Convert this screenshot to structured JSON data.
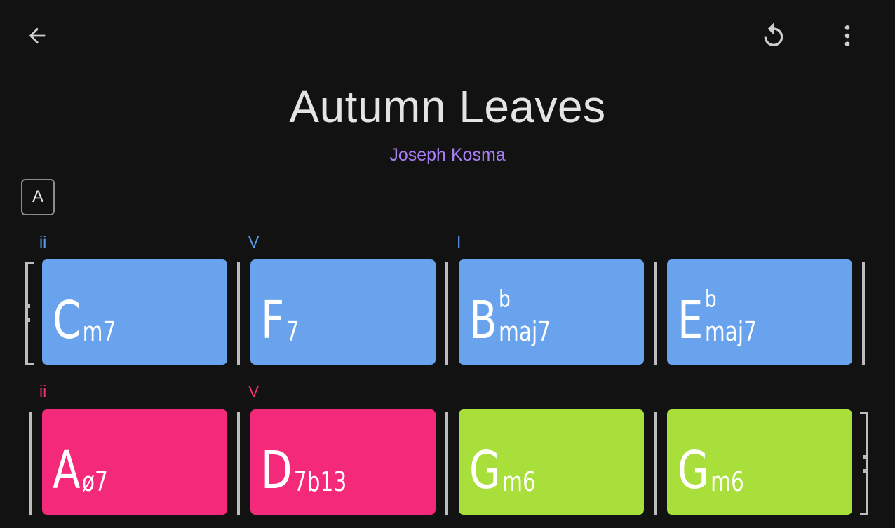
{
  "toolbar": {
    "back_icon": "arrow-back-icon",
    "reset_icon": "refresh-icon",
    "more_icon": "more-vert-icon"
  },
  "song": {
    "title": "Autumn Leaves",
    "composer": "Joseph Kosma"
  },
  "section": {
    "label": "A"
  },
  "colors": {
    "background": "#121212",
    "blue": "#6aa3ed",
    "pink": "#f5297a",
    "green": "#a9df3b",
    "blue_numeral": "#5b9ee8",
    "pink_numeral": "#f0306f",
    "composer": "#a87ef5"
  },
  "rows": [
    {
      "numerals": [
        "ii",
        "V",
        "I",
        ""
      ],
      "chords": [
        {
          "root": "C",
          "accidental": "",
          "quality": "m7",
          "color": "#6aa3ed"
        },
        {
          "root": "F",
          "accidental": "",
          "quality": "7",
          "color": "#6aa3ed"
        },
        {
          "root": "B",
          "accidental": "b",
          "quality": "maj7",
          "color": "#6aa3ed"
        },
        {
          "root": "E",
          "accidental": "b",
          "quality": "maj7",
          "color": "#6aa3ed"
        }
      ]
    },
    {
      "numerals": [
        "ii",
        "V",
        "",
        ""
      ],
      "chords": [
        {
          "root": "A",
          "accidental": "",
          "quality": "ø7",
          "color": "#f5297a"
        },
        {
          "root": "D",
          "accidental": "",
          "quality": "7b13",
          "color": "#f5297a"
        },
        {
          "root": "G",
          "accidental": "",
          "quality": "m6",
          "color": "#a9df3b"
        },
        {
          "root": "G",
          "accidental": "",
          "quality": "m6",
          "color": "#a9df3b"
        }
      ]
    }
  ]
}
